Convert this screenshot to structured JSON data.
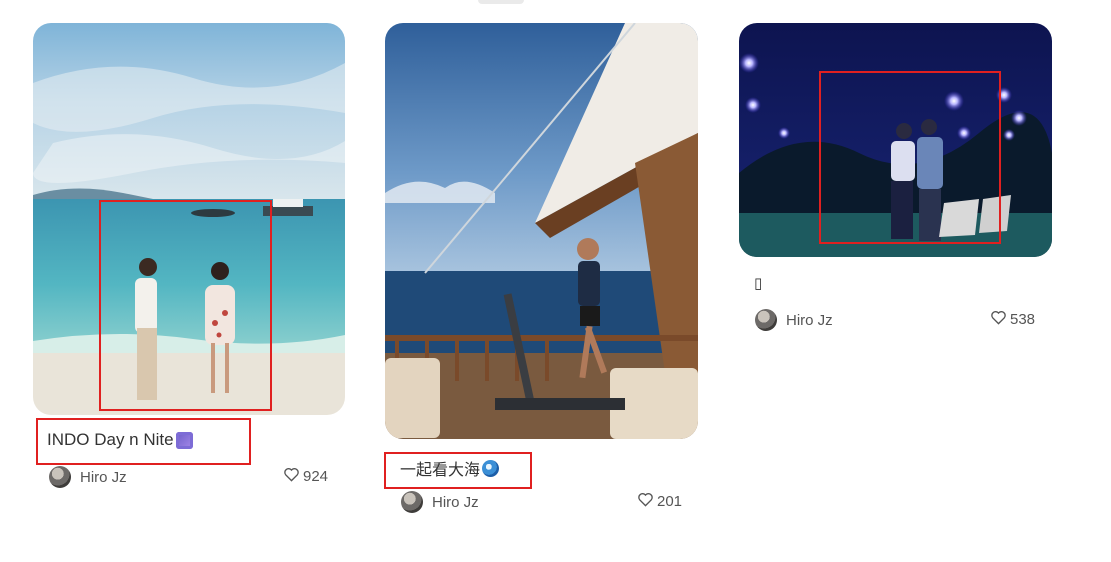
{
  "feed": {
    "cards": [
      {
        "title": "INDO Day n Nite",
        "emoji": "purple-square-emoji",
        "author": "Hiro Jz",
        "likes": "924"
      },
      {
        "title": "一起看大海",
        "emoji": "blue-swirl-emoji",
        "author": "Hiro Jz",
        "likes": "201"
      },
      {
        "title": "▯",
        "emoji": "",
        "author": "Hiro Jz",
        "likes": "538"
      }
    ]
  },
  "colors": {
    "highlight_box": "#e02020",
    "text": "#333333"
  }
}
